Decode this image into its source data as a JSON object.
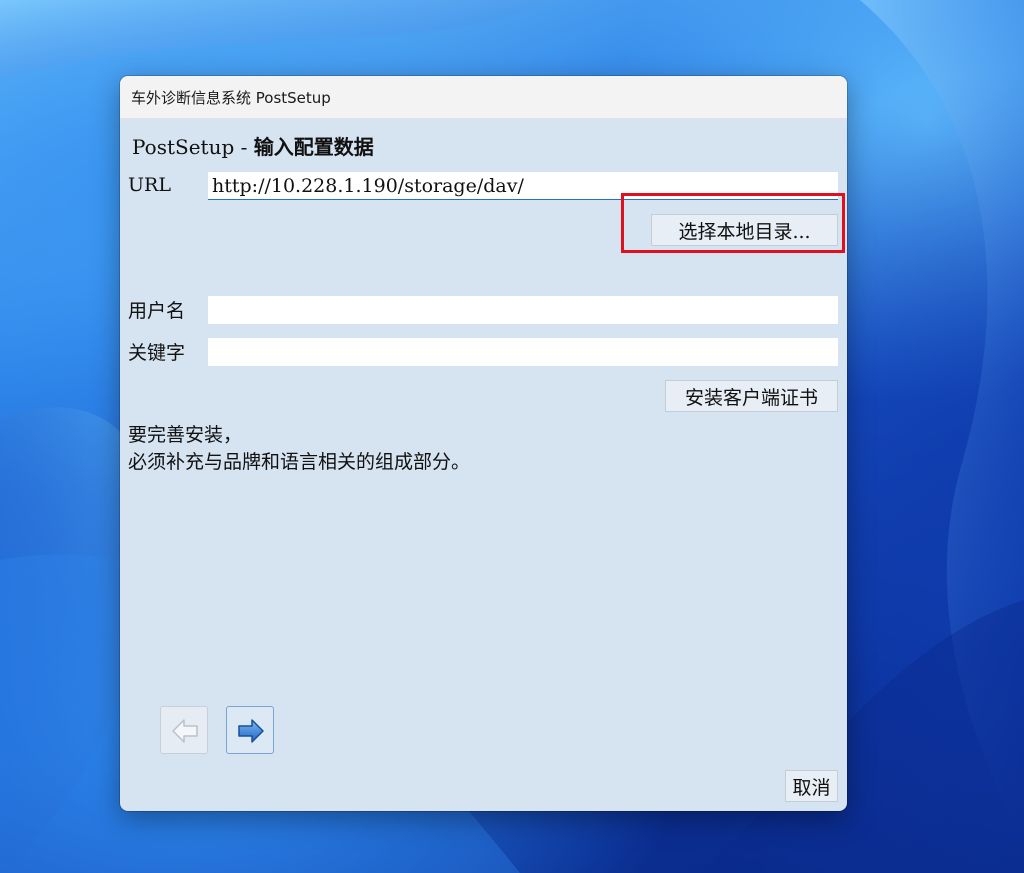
{
  "window": {
    "title": "车外诊断信息系统 PostSetup"
  },
  "page": {
    "heading_prefix": "PostSetup - ",
    "heading_bold": "输入配置数据"
  },
  "form": {
    "url_label": "URL",
    "url_value": "http://10.228.1.190/storage/dav/",
    "choose_dir_label": "选择本地目录...",
    "username_label": "用户名",
    "username_value": "",
    "password_label": "关键字",
    "password_value": "",
    "install_cert_label": "安装客户端证书"
  },
  "info": {
    "line1": "要完善安装，",
    "line2": "必须补充与品牌和语言相关的组成部分。"
  },
  "footer": {
    "cancel_label": "取消",
    "back_icon": "arrow-left-icon",
    "next_icon": "arrow-right-icon"
  },
  "colors": {
    "highlight": "#e0101e",
    "dialog_background": "#d6e3f1",
    "next_arrow": "#2f7fd8"
  }
}
